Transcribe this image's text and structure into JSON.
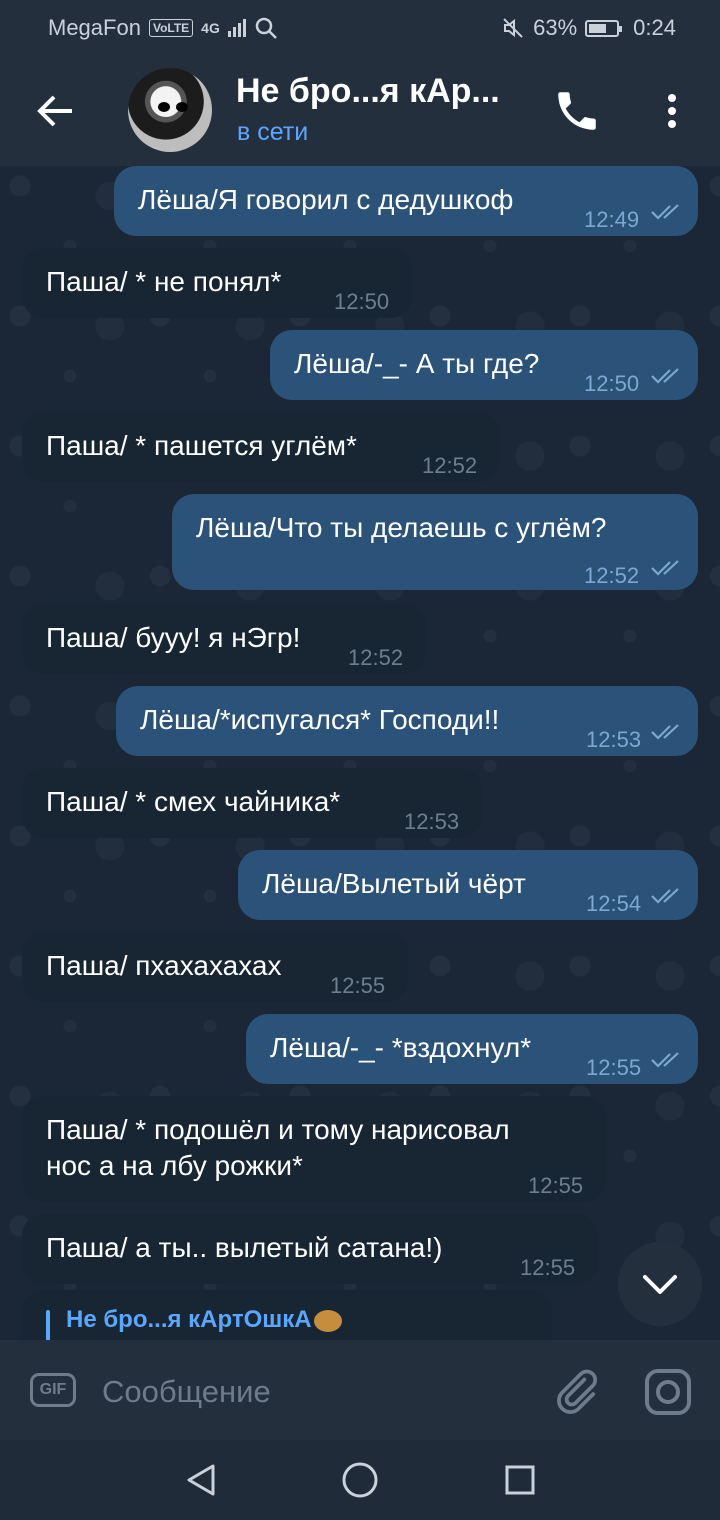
{
  "status_bar": {
    "carrier": "MegaFon",
    "volte": "VoLTE",
    "network": "4G",
    "battery_percent": "63%",
    "battery_level": 0.63,
    "time": "0:24"
  },
  "header": {
    "title": "Не бро...я кАр...",
    "status": "в сети"
  },
  "messages": [
    {
      "dir": "out",
      "text": "Лёша/Я говорил с дедушкоф",
      "time": "12:49"
    },
    {
      "dir": "in",
      "text": "Паша/ * не понял*",
      "time": "12:50"
    },
    {
      "dir": "out",
      "text": "Лёша/-_- А ты где?",
      "time": "12:50"
    },
    {
      "dir": "in",
      "text": "Паша/ * пашется углём*",
      "time": "12:52"
    },
    {
      "dir": "out",
      "text": "Лёша/Что ты делаешь с углём?",
      "time": "12:52"
    },
    {
      "dir": "in",
      "text": "Паша/ бууу! я нЭгр!",
      "time": "12:52"
    },
    {
      "dir": "out",
      "text": "Лёша/*испугался* Господи!!",
      "time": "12:53"
    },
    {
      "dir": "in",
      "text": "Паша/ * смех чайника*",
      "time": "12:53"
    },
    {
      "dir": "out",
      "text": "Лёша/Вылетый чёрт",
      "time": "12:54"
    },
    {
      "dir": "in",
      "text": "Паша/ пхахахахах",
      "time": "12:55"
    },
    {
      "dir": "out",
      "text": "Лёша/-_- *вздохнул*",
      "time": "12:55"
    },
    {
      "dir": "in",
      "text_line1": "Паша/ * подошёл и тому нарисовал",
      "text_line2": "нос а на лбу рожки*",
      "time": "12:55"
    },
    {
      "dir": "in",
      "text": "Паша/ а ты.. вылетый сатана!)",
      "time": "12:55"
    }
  ],
  "reply_preview": {
    "name": "Не бро...я кАртОшкА"
  },
  "input": {
    "gif_label": "GIF",
    "placeholder": "Сообщение"
  },
  "icons": {
    "back": "arrow-left-icon",
    "call": "phone-icon",
    "menu": "more-vertical-icon",
    "scroll": "chevron-down-icon",
    "attach": "paperclip-icon",
    "camera": "camera-icon",
    "read": "double-check-icon"
  },
  "colors": {
    "background": "#1b2637",
    "header": "#242f3e",
    "outgoing_bubble": "#2b5278",
    "incoming_bubble": "#182533",
    "accent": "#5aa7ff"
  }
}
